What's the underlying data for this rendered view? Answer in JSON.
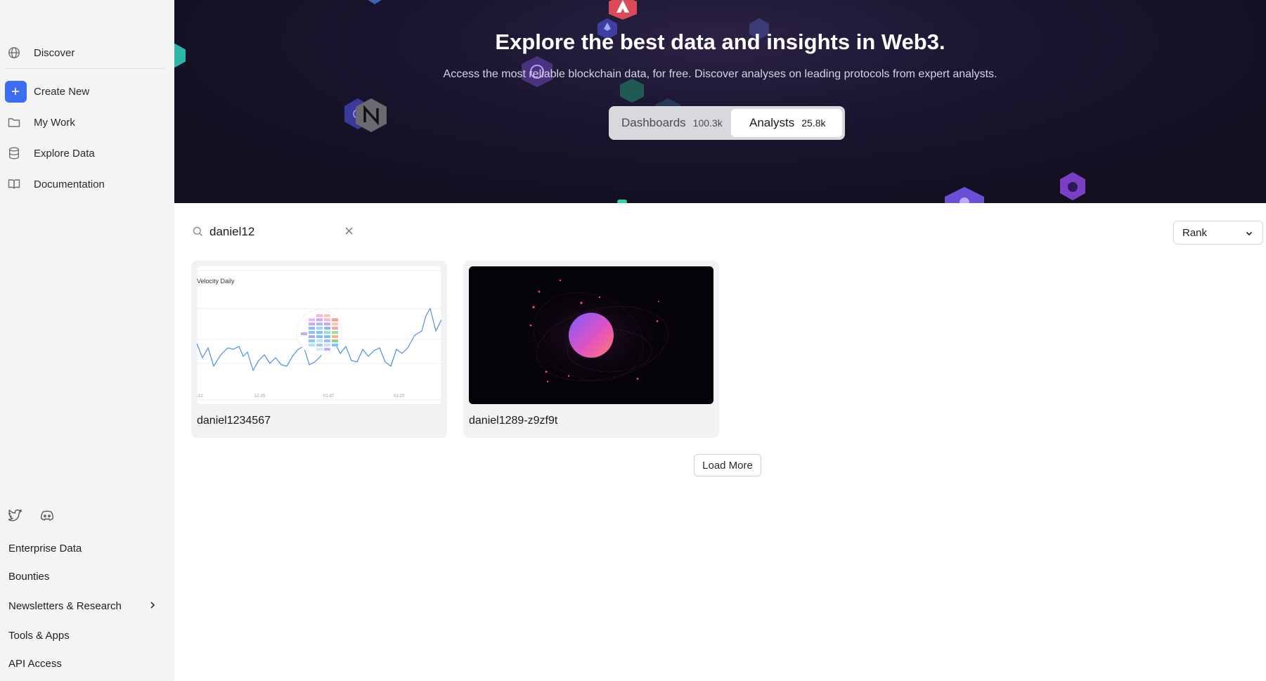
{
  "sidebar": {
    "nav": [
      {
        "label": "Discover",
        "icon": "globe-icon"
      },
      {
        "label": "Create New",
        "icon": "plus-icon"
      },
      {
        "label": "My Work",
        "icon": "folder-icon"
      },
      {
        "label": "Explore Data",
        "icon": "database-icon"
      },
      {
        "label": "Documentation",
        "icon": "book-icon"
      }
    ],
    "social": [
      "twitter-icon",
      "discord-icon"
    ],
    "footer_links": [
      {
        "label": "Enterprise Data"
      },
      {
        "label": "Bounties"
      },
      {
        "label": "Newsletters & Research"
      },
      {
        "label": "Tools & Apps"
      },
      {
        "label": "API Access"
      }
    ]
  },
  "hero": {
    "title": "Explore the best data and insights in Web3.",
    "subtitle": "Access the most reliable blockchain data, for free. Discover analyses on leading protocols from expert analysts.",
    "tabs": [
      {
        "label": "Dashboards",
        "count": "100.3k",
        "selected": false
      },
      {
        "label": "Analysts",
        "count": "25.8k",
        "selected": true
      }
    ]
  },
  "search": {
    "value": "daniel12"
  },
  "sort": {
    "selected": "Rank"
  },
  "results": [
    {
      "name": "daniel1234567",
      "thumb_title": "Velocity Daily",
      "thumb_ticks": [
        "-12",
        "12-25",
        "01-07",
        "01-20"
      ]
    },
    {
      "name": "daniel1289-z9zf9t"
    }
  ],
  "load_more_label": "Load More",
  "colors": {
    "accent": "#3b6ef5",
    "hero_bg": "#1a1530",
    "sidebar_bg": "#f4f4f5"
  }
}
